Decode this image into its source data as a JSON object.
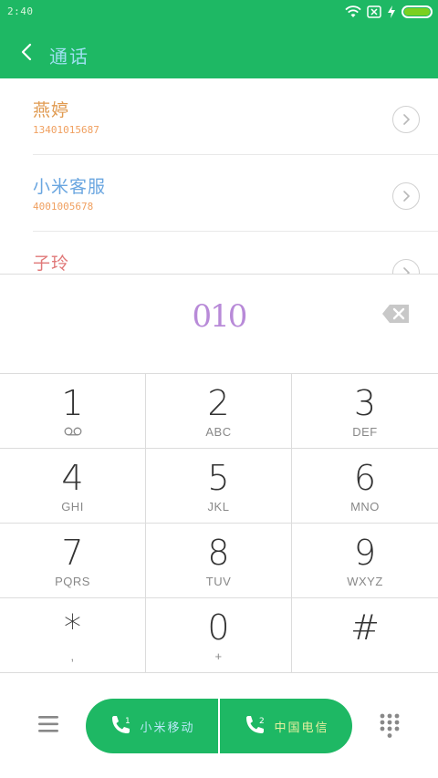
{
  "status_bar": {
    "time": "2:40",
    "icons": [
      "wifi-icon",
      "sim-off-icon",
      "charging-icon",
      "battery-icon"
    ]
  },
  "header": {
    "title": "通话",
    "back_icon": "chevron-left-icon"
  },
  "contacts": [
    {
      "name": "燕婷",
      "number": "13401015687",
      "name_color": "#e09a50"
    },
    {
      "name": "小米客服",
      "number": "4001005678",
      "name_color": "#6aa6e0"
    },
    {
      "name": "子玲",
      "number": "",
      "name_color": "#e07878"
    }
  ],
  "dialer": {
    "dialed_number": "010",
    "backspace_icon": "backspace-icon"
  },
  "keypad": [
    {
      "digit": "1",
      "letters": ""
    },
    {
      "digit": "2",
      "letters": "ABC"
    },
    {
      "digit": "3",
      "letters": "DEF"
    },
    {
      "digit": "4",
      "letters": "GHI"
    },
    {
      "digit": "5",
      "letters": "JKL"
    },
    {
      "digit": "6",
      "letters": "MNO"
    },
    {
      "digit": "7",
      "letters": "PQRS"
    },
    {
      "digit": "8",
      "letters": "TUV"
    },
    {
      "digit": "9",
      "letters": "WXYZ"
    },
    {
      "digit": "*",
      "letters": ","
    },
    {
      "digit": "0",
      "letters": "+"
    },
    {
      "digit": "#",
      "letters": ""
    }
  ],
  "bottom_bar": {
    "menu_icon": "menu-icon",
    "sim1": {
      "label": "小米移动",
      "sim_number": "1"
    },
    "sim2": {
      "label": "中国电信",
      "sim_number": "2"
    },
    "dialpad_icon": "dialpad-icon"
  },
  "colors": {
    "accent": "#1eb864",
    "divider": "#dcdcdc"
  }
}
